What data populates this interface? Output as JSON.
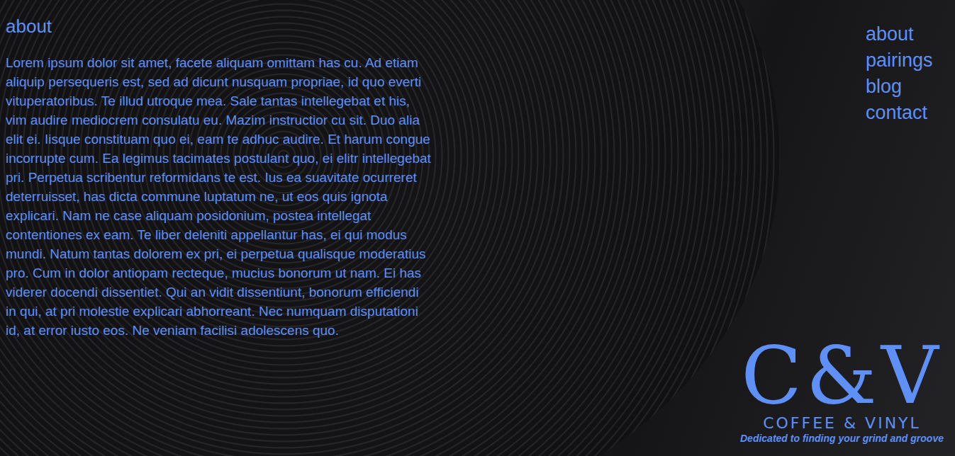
{
  "page": {
    "heading": "about",
    "body": "Lorem ipsum dolor sit amet, facete aliquam omittam has cu. Ad etiam aliquip persequeris est, sed ad dicunt nusquam propriae, id quo everti vituperatoribus. Te illud utroque mea. Sale tantas intellegebat et his, vim audire mediocrem consulatu eu. Mazim instructior cu sit. Duo alia elit ei. Iisque constituam quo ei, eam te adhuc audire. Et harum congue incorrupte cum. Ea legimus tacimates postulant quo, ei elitr intellegebat pri. Perpetua scribentur reformidans te est. Ius ea suavitate ocurreret deterruisset, has dicta commune luptatum ne, ut eos quis ignota explicari. Nam ne case aliquam posidonium, postea intellegat contentiones ex eam. Te liber deleniti appellantur has, ei qui modus mundi. Natum tantas dolorem ex pri, ei perpetua qualisque moderatius pro. Cum in dolor antiopam recteque, mucius bonorum ut nam. Ei has viderer docendi dissentiet. Qui an vidit dissentiunt, bonorum efficiendi in qui, at pri molestie explicari abhorreant. Nec numquam disputationi id, at error iusto eos. Ne veniam facilisi adolescens quo."
  },
  "nav": {
    "items": [
      {
        "label": "about",
        "selected": false
      },
      {
        "label": "pairings",
        "selected": false
      },
      {
        "label": "blog",
        "selected": false
      },
      {
        "label": "contact",
        "selected": false
      }
    ]
  },
  "logo": {
    "mark": "C&V",
    "name": "COFFEE & VINYL",
    "tagline": "Dedicated to finding your grind and groove"
  }
}
